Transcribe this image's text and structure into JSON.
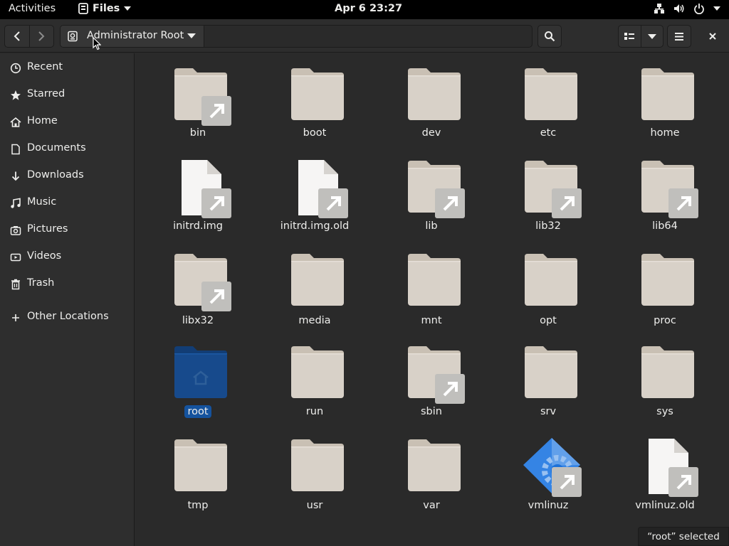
{
  "topbar": {
    "activities": "Activities",
    "app_name": "Files",
    "clock": "Apr 6  23:27"
  },
  "headerbar": {
    "location_label": "Administrator Root"
  },
  "sidebar": {
    "items": [
      {
        "label": "Recent",
        "icon": "clock-icon"
      },
      {
        "label": "Starred",
        "icon": "star-icon"
      },
      {
        "label": "Home",
        "icon": "home-icon"
      },
      {
        "label": "Documents",
        "icon": "document-icon"
      },
      {
        "label": "Downloads",
        "icon": "download-icon"
      },
      {
        "label": "Music",
        "icon": "music-icon"
      },
      {
        "label": "Pictures",
        "icon": "camera-icon"
      },
      {
        "label": "Videos",
        "icon": "video-icon"
      },
      {
        "label": "Trash",
        "icon": "trash-icon"
      },
      {
        "label": "Other Locations",
        "icon": "plus-icon"
      }
    ]
  },
  "files": [
    {
      "name": "bin",
      "kind": "folder",
      "link": true
    },
    {
      "name": "boot",
      "kind": "folder",
      "link": false
    },
    {
      "name": "dev",
      "kind": "folder",
      "link": false
    },
    {
      "name": "etc",
      "kind": "folder",
      "link": false
    },
    {
      "name": "home",
      "kind": "folder",
      "link": false
    },
    {
      "name": "initrd.img",
      "kind": "file",
      "link": true
    },
    {
      "name": "initrd.img.old",
      "kind": "file",
      "link": true
    },
    {
      "name": "lib",
      "kind": "folder",
      "link": true
    },
    {
      "name": "lib32",
      "kind": "folder",
      "link": true
    },
    {
      "name": "lib64",
      "kind": "folder",
      "link": true
    },
    {
      "name": "libx32",
      "kind": "folder",
      "link": true
    },
    {
      "name": "media",
      "kind": "folder",
      "link": false
    },
    {
      "name": "mnt",
      "kind": "folder",
      "link": false
    },
    {
      "name": "opt",
      "kind": "folder",
      "link": false
    },
    {
      "name": "proc",
      "kind": "folder",
      "link": false
    },
    {
      "name": "root",
      "kind": "home-folder",
      "link": false,
      "selected": true
    },
    {
      "name": "run",
      "kind": "folder",
      "link": false
    },
    {
      "name": "sbin",
      "kind": "folder",
      "link": true
    },
    {
      "name": "srv",
      "kind": "folder",
      "link": false
    },
    {
      "name": "sys",
      "kind": "folder",
      "link": false
    },
    {
      "name": "tmp",
      "kind": "folder",
      "link": false
    },
    {
      "name": "usr",
      "kind": "folder",
      "link": false
    },
    {
      "name": "var",
      "kind": "folder",
      "link": false
    },
    {
      "name": "vmlinuz",
      "kind": "executable",
      "link": true
    },
    {
      "name": "vmlinuz.old",
      "kind": "file",
      "link": true
    }
  ],
  "status": {
    "text": "“root” selected"
  },
  "colors": {
    "folder": "#d8d1c8",
    "folder_tab": "#c9c0b4",
    "selected_folder": "#174a8c",
    "selection": "#15539e",
    "file": "#f6f5f4"
  }
}
